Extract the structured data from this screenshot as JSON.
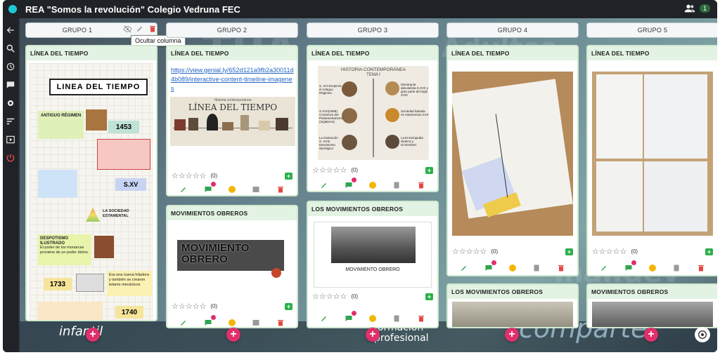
{
  "app": {
    "title": "REA \"Somos la revolución\" Colegio Vedruna FEC",
    "user_count": "1"
  },
  "tooltip": "Ocultar columna",
  "columns": [
    {
      "name": "GRUPO 1"
    },
    {
      "name": "GRUPO 2"
    },
    {
      "name": "GRUPO 3"
    },
    {
      "name": "GRUPO 4"
    },
    {
      "name": "GRUPO 5"
    }
  ],
  "cards": {
    "c1": {
      "title": "LÍNEA DEL TIEMPO"
    },
    "c2": {
      "title": "LÍNEA DEL TIEMPO",
      "link": "https://view.genial.ly/652d121a9fb2a30011d4b089/interactive-content-timeline-imagenes",
      "count": "(0)"
    },
    "c2b": {
      "title": "MOVIMIENTOS OBREROS",
      "count": "(0)"
    },
    "c3": {
      "title": "LÍNEA DEL TIEMPO",
      "count": "(0)"
    },
    "c3b": {
      "title": "LOS MOVIMIENTOS OBREROS",
      "count": "(0)"
    },
    "c4": {
      "title": "LÍNEA DEL TIEMPO",
      "count": "(0)"
    },
    "c4b": {
      "title": "LOS MOVIMIENTOS OBREROS"
    },
    "c5": {
      "title": "LÍNEA DEL TIEMPO",
      "count": "(0)"
    },
    "c5b": {
      "title": "MOVIMIENTOS OBREROS"
    }
  },
  "timeline_poster": {
    "heading": "LINEA DEL TIEMPO",
    "sections": [
      {
        "title": "ANTIGUO RÉGIMEN",
        "year": "1453"
      },
      {
        "title": "S.XV"
      },
      {
        "title": "LA SOCIEDAD ESTAMENTAL"
      },
      {
        "title": "DESPOTISMO ILUSTRADO",
        "text": "El poder de los monarcas proviene de un poder divino."
      },
      {
        "year": "1733",
        "text": "Era una nueva hiladora y también se crearon telares mecánicos"
      },
      {
        "year": "1740"
      }
    ]
  },
  "genially_slide": {
    "subtitle": "Historia contemporánea",
    "heading": "LÍNEA DEL TIEMPO"
  },
  "history_slide": {
    "heading": "HISTORIA CONTEMPORÁNEA",
    "subheading": "TEMA I",
    "items_left": [
      "S. XVI Empieza el Antiguo Régimen",
      "S.XVII(1688) Comienza del Parlamentarismo (Inglaterra)",
      "La Ilustración S. XVIII Movimiento ideológico"
    ],
    "items_right": [
      "Monarquía absolutista S.XVII y gran parte del siglo XVIII",
      "Sociedad basada en estamentos XVII",
      "La Enciclopedia Diderot y D'Alembert"
    ]
  },
  "movimiento_card": {
    "image_text": "MOVIMIENTO OBRERO"
  },
  "movimiento_slide": {
    "caption": "MOVIMIENTO OBRERO"
  },
  "footer_text": {
    "left": "infantil",
    "middle": "formación profesional",
    "right": "comparte"
  },
  "colors": {
    "accent": "#e0306b",
    "card_border": "#cfe9cf",
    "card_header": "#e3f3e3",
    "add_button": "#2bb04a"
  }
}
